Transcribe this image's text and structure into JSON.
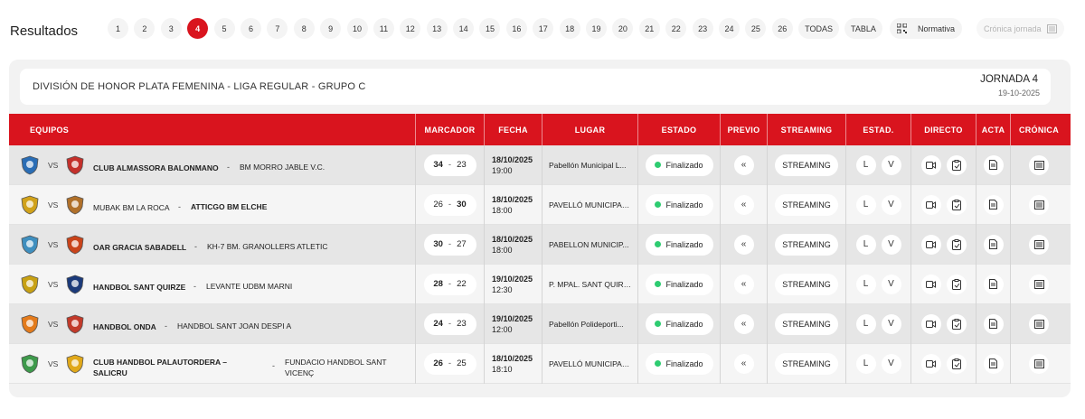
{
  "header": {
    "title": "Resultados",
    "pages": [
      "1",
      "2",
      "3",
      "4",
      "5",
      "6",
      "7",
      "8",
      "9",
      "10",
      "11",
      "12",
      "13",
      "14",
      "15",
      "16",
      "17",
      "18",
      "19",
      "20",
      "21",
      "22",
      "23",
      "24",
      "25",
      "26"
    ],
    "active_page": "4",
    "todas_label": "TODAS",
    "tabla_label": "TABLA",
    "normativa_label": "Normativa",
    "cronica_jornada_label": "Crónica jornada"
  },
  "competition": {
    "name": "DIVISIÓN DE HONOR PLATA FEMENINA - LIGA REGULAR - GRUPO C",
    "jornada": "JORNADA 4",
    "date": "19-10-2025"
  },
  "columns": {
    "equipos": "EQUIPOS",
    "marcador": "MARCADOR",
    "fecha": "FECHA",
    "lugar": "LUGAR",
    "estado": "ESTADO",
    "previo": "PREVIO",
    "streaming": "STREAMING",
    "estad": "ESTAD.",
    "directo": "DIRECTO",
    "acta": "ACTA",
    "cronica": "CRÓNICA"
  },
  "labels": {
    "vs": "VS",
    "dash": "-",
    "score_sep": "-",
    "estado": "Finalizado",
    "streaming": "STREAMING",
    "local": "L",
    "visitante": "V"
  },
  "matches": [
    {
      "home": "CLUB ALMASSORA BALONMANO",
      "away": "BM MORRO JABLE V.C.",
      "home_score": "34",
      "away_score": "23",
      "winner": "home",
      "date": "18/10/2025",
      "time": "19:00",
      "place": "Pabellón Municipal L...",
      "home_color": "#2a6db5",
      "away_color": "#c4302b"
    },
    {
      "home": "MUBAK BM LA ROCA",
      "away": "ATTICGO BM ELCHE",
      "home_score": "26",
      "away_score": "30",
      "winner": "away",
      "date": "18/10/2025",
      "time": "18:00",
      "place": "PAVELLÓ MUNICIPAL...",
      "home_color": "#d1a21a",
      "away_color": "#b0702a"
    },
    {
      "home": "OAR GRACIA SABADELL",
      "away": "KH-7 BM. GRANOLLERS ATLETIC",
      "home_score": "30",
      "away_score": "27",
      "winner": "home",
      "date": "18/10/2025",
      "time": "18:00",
      "place": "PABELLON MUNICIP...",
      "home_color": "#3f8fbf",
      "away_color": "#c9431a"
    },
    {
      "home": "HANDBOL SANT QUIRZE",
      "away": "LEVANTE UDBM MARNI",
      "home_score": "28",
      "away_score": "22",
      "winner": "home",
      "date": "19/10/2025",
      "time": "12:30",
      "place": "P. MPAL. SANT QUIRZE",
      "home_color": "#c8a114",
      "away_color": "#1b3a7a"
    },
    {
      "home": "HANDBOL ONDA",
      "away": "HANDBOL SANT JOAN DESPI A",
      "home_score": "24",
      "away_score": "23",
      "winner": "home",
      "date": "19/10/2025",
      "time": "12:00",
      "place": "Pabellón Polideporti...",
      "home_color": "#e37b1c",
      "away_color": "#c23a2a"
    },
    {
      "home": "CLUB HANDBOL PALAUTORDERA – SALICRU",
      "away": "FUNDACIO HANDBOL SANT VICENÇ",
      "home_score": "26",
      "away_score": "25",
      "winner": "home",
      "date": "18/10/2025",
      "time": "18:10",
      "place": "PAVELLÓ MUNICIPAL...",
      "home_color": "#3e9a4b",
      "away_color": "#e0a81a"
    }
  ],
  "icons": {
    "previo": "double-chevron-left-icon",
    "video": "video-camera-icon",
    "live": "clipboard-icon",
    "acta": "document-icon",
    "cronica": "newspaper-icon",
    "normativa": "qr-code-icon"
  }
}
